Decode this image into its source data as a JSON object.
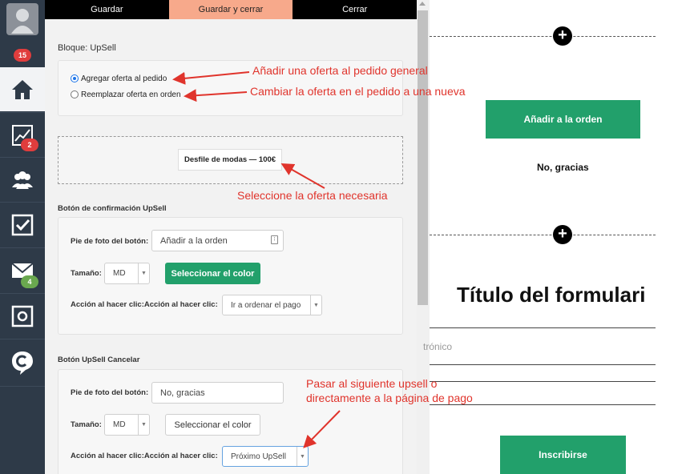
{
  "sidebar": {
    "notifications_badge": "15",
    "stats_badge": "2",
    "mail_badge": "4"
  },
  "toolbar": {
    "save": "Guardar",
    "save_close": "Guardar y cerrar",
    "close": "Cerrar"
  },
  "block": {
    "title": "Bloque: UpSell",
    "radio_add": "Agregar oferta al pedido",
    "radio_replace": "Reemplazar oferta en orden",
    "offer_chip": "Desfile de modas — 100€"
  },
  "confirm_section": {
    "title": "Botón de confirmación UpSell",
    "caption_label": "Pie de foto del botón:",
    "caption_value": "Añadir a la orden",
    "size_label": "Tamaño:",
    "size_value": "MD",
    "color_button": "Seleccionar el color",
    "action_label": "Acción al hacer clic:Acción al hacer clic:",
    "action_value": "Ir a ordenar el pago"
  },
  "cancel_section": {
    "title": "Botón UpSell Cancelar",
    "caption_label": "Pie de foto del botón:",
    "caption_value": "No, gracias",
    "size_label": "Tamaño:",
    "size_value": "MD",
    "color_button": "Seleccionar el color",
    "action_label": "Acción al hacer clic:Acción al hacer clic:",
    "action_value": "Próximo UpSell"
  },
  "annotations": {
    "a1": "Añadir una oferta al pedido general",
    "a2": "Cambiar la oferta en el pedido a una nueva",
    "a3": "Seleccione la oferta necesaria",
    "a4_line1": "Pasar al siguiente upsell o",
    "a4_line2": "directamente a la página de pago"
  },
  "preview": {
    "add_button": "Añadir a la orden",
    "no_thanks": "No, gracias",
    "form_title": "Título del formulari",
    "email_placeholder": "trónico",
    "subscribe": "Inscribirse"
  },
  "colors": {
    "green": "#22a06b",
    "annotation_red": "#e0342c",
    "sidebar": "#2e3a48",
    "orange_tab": "#f7a98b"
  }
}
